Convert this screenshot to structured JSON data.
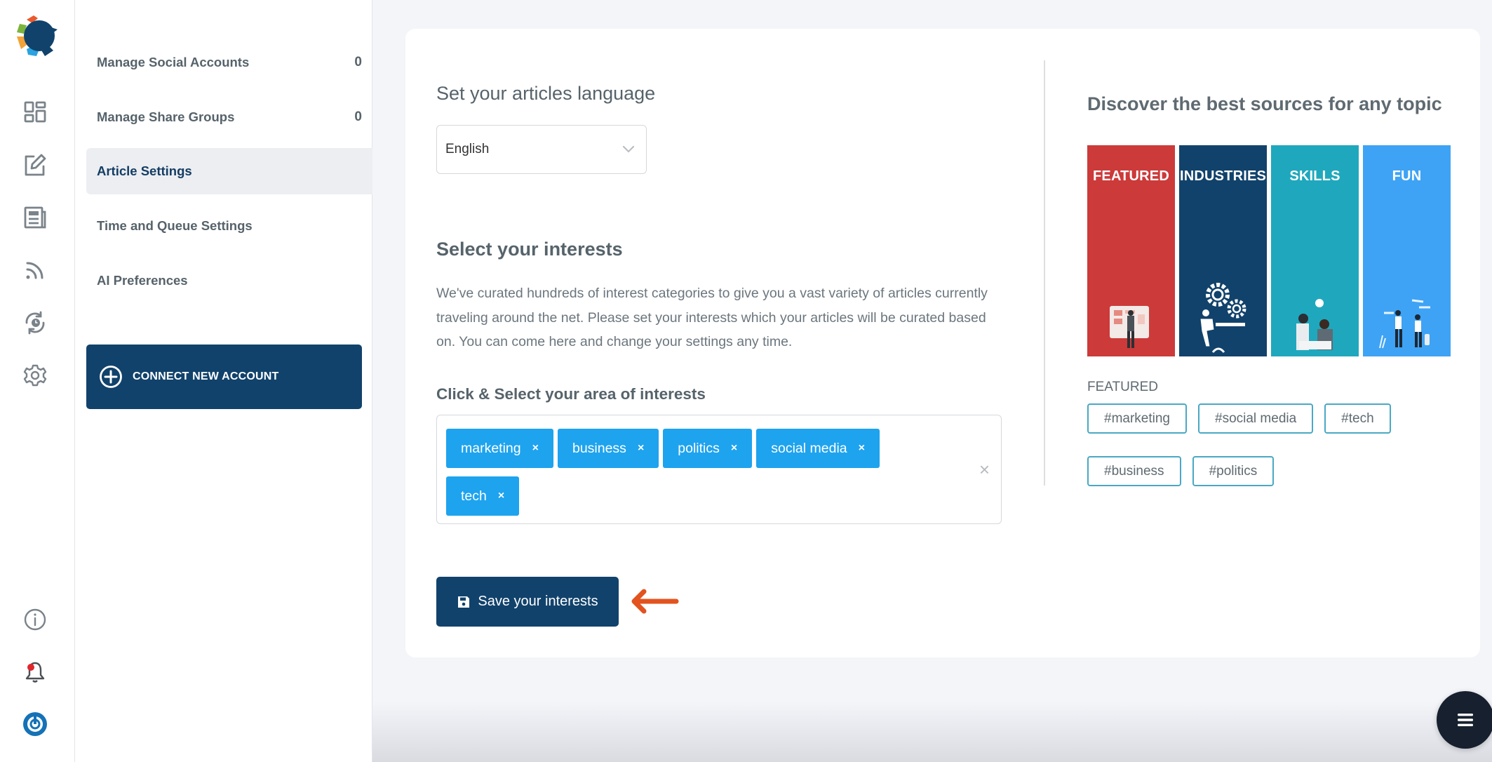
{
  "rail": {
    "logo": "brand-logo",
    "top_icons": [
      "dashboard-icon",
      "compose-icon",
      "articles-icon",
      "rss-feed-icon",
      "scheduled-sync-icon",
      "settings-gear-icon"
    ],
    "bottom_icons": [
      "info-icon",
      "notifications-bell-icon",
      "power-icon"
    ],
    "notification_dot_color": "#e0262d",
    "power_color": "#1572b6"
  },
  "nav": {
    "items": [
      {
        "label": "Manage Social Accounts",
        "count": "0",
        "active": false
      },
      {
        "label": "Manage Share Groups",
        "count": "0",
        "active": false
      },
      {
        "label": "Article Settings",
        "count": "",
        "active": true
      },
      {
        "label": "Time and Queue Settings",
        "count": "",
        "active": false
      },
      {
        "label": "AI Preferences",
        "count": "",
        "active": false
      }
    ],
    "connect_button": "CONNECT NEW ACCOUNT"
  },
  "main": {
    "language_heading": "Set your articles language",
    "language_value": "English",
    "interests_heading": "Select your interests",
    "interests_description": "We've curated hundreds of interest categories to give you a vast variety of articles currently traveling around the net. Please set your interests which your articles will be curated based on. You can come here and change your settings any time.",
    "area_heading": "Click & Select your area of interests",
    "selected_tags": [
      "marketing",
      "business",
      "politics",
      "social media",
      "tech"
    ],
    "tag_remove_glyph": "×",
    "clear_all_glyph": "×",
    "save_button": "Save your interests"
  },
  "discover": {
    "heading": "Discover the best sources for any topic",
    "tiles": [
      {
        "label": "FEATURED",
        "color": "#cc3a3a"
      },
      {
        "label": "INDUSTRIES",
        "color": "#11426b"
      },
      {
        "label": "SKILLS",
        "color": "#1fa8bd"
      },
      {
        "label": "FUN",
        "color": "#3ea3f4"
      }
    ],
    "featured_label": "FEATURED",
    "featured_tags_row1": [
      "#marketing",
      "#social media",
      "#tech"
    ],
    "featured_tags_row2": [
      "#business",
      "#politics"
    ]
  },
  "colors": {
    "primary_navy": "#11426b",
    "tag_blue": "#1ea3ef",
    "arrow_orange": "#e2531f",
    "fab_dark": "#17202e"
  }
}
